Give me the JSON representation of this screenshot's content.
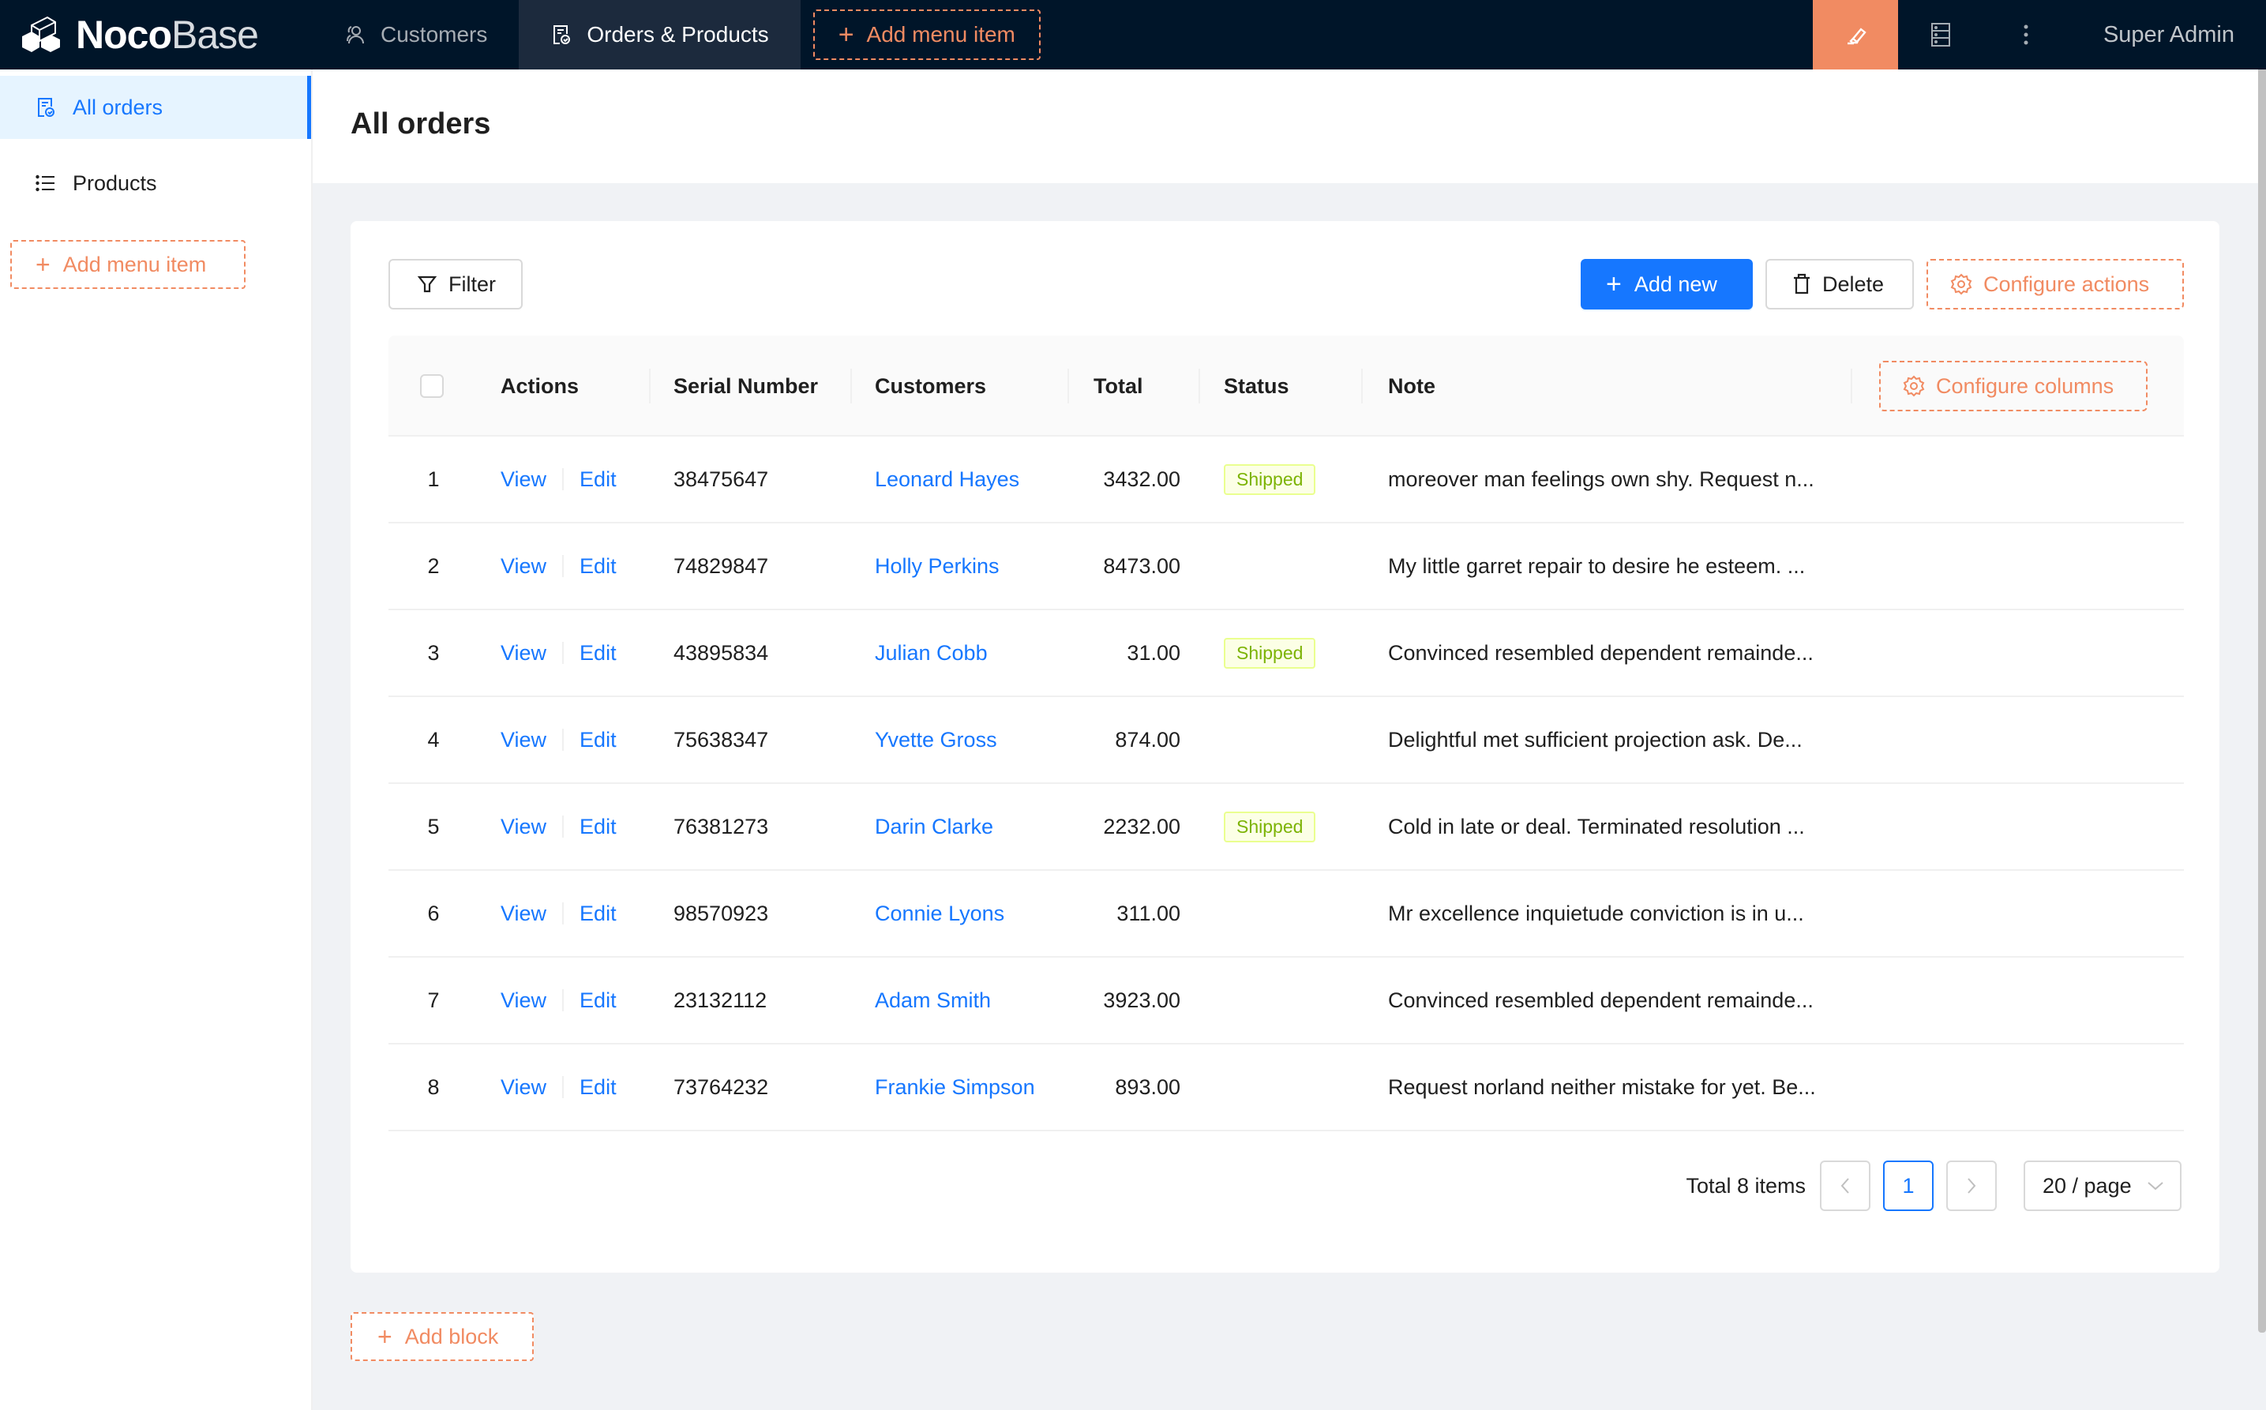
{
  "app": {
    "logo_bold": "Noco",
    "logo_light": "Base",
    "user_name": "Super Admin"
  },
  "topnav": {
    "items": [
      {
        "label": "Customers",
        "icon": "users-icon",
        "active": false
      },
      {
        "label": "Orders & Products",
        "icon": "order-doc-icon",
        "active": true
      }
    ],
    "add_menu_label": "Add menu item",
    "right_icons": [
      "highlighter-icon",
      "database-icon",
      "more-vertical-icon"
    ]
  },
  "sidebar": {
    "items": [
      {
        "label": "All orders",
        "icon": "order-doc-icon",
        "active": true
      },
      {
        "label": "Products",
        "icon": "list-icon",
        "active": false
      }
    ],
    "add_menu_label": "Add menu item"
  },
  "page": {
    "title": "All orders"
  },
  "toolbar": {
    "filter_label": "Filter",
    "add_new_label": "Add new",
    "delete_label": "Delete",
    "configure_actions_label": "Configure actions"
  },
  "table": {
    "columns": [
      "Actions",
      "Serial Number",
      "Customers",
      "Total",
      "Status",
      "Note"
    ],
    "configure_columns_label": "Configure columns",
    "view_label": "View",
    "edit_label": "Edit",
    "rows": [
      {
        "index": "1",
        "serial": "38475647",
        "customer": "Leonard Hayes",
        "total": "3432.00",
        "status": "Shipped",
        "note": "moreover man feelings own shy. Request n..."
      },
      {
        "index": "2",
        "serial": "74829847",
        "customer": "Holly Perkins",
        "total": "8473.00",
        "status": "",
        "note": "My little garret repair to desire he esteem. ..."
      },
      {
        "index": "3",
        "serial": "43895834",
        "customer": "Julian Cobb",
        "total": "31.00",
        "status": "Shipped",
        "note": "Convinced resembled dependent remainde..."
      },
      {
        "index": "4",
        "serial": "75638347",
        "customer": "Yvette Gross",
        "total": "874.00",
        "status": "",
        "note": "Delightful met sufficient projection ask. De..."
      },
      {
        "index": "5",
        "serial": "76381273",
        "customer": "Darin Clarke",
        "total": "2232.00",
        "status": "Shipped",
        "note": "Cold in late or deal. Terminated resolution ..."
      },
      {
        "index": "6",
        "serial": "98570923",
        "customer": "Connie Lyons",
        "total": "311.00",
        "status": "",
        "note": "Mr excellence inquietude conviction is in u..."
      },
      {
        "index": "7",
        "serial": "23132112",
        "customer": "Adam Smith",
        "total": "3923.00",
        "status": "",
        "note": "Convinced resembled dependent remainde..."
      },
      {
        "index": "8",
        "serial": "73764232",
        "customer": "Frankie Simpson",
        "total": "893.00",
        "status": "",
        "note": "Request norland neither mistake for yet. Be..."
      }
    ]
  },
  "pagination": {
    "total_text": "Total 8 items",
    "current_page": "1",
    "page_size": "20 / page"
  },
  "add_block_label": "Add block",
  "colors": {
    "header_bg": "#001529",
    "primary": "#1677ff",
    "design_accent": "#f18b62",
    "tag_shipped_text": "#7cb305",
    "tag_shipped_bg": "#fcffe6"
  }
}
